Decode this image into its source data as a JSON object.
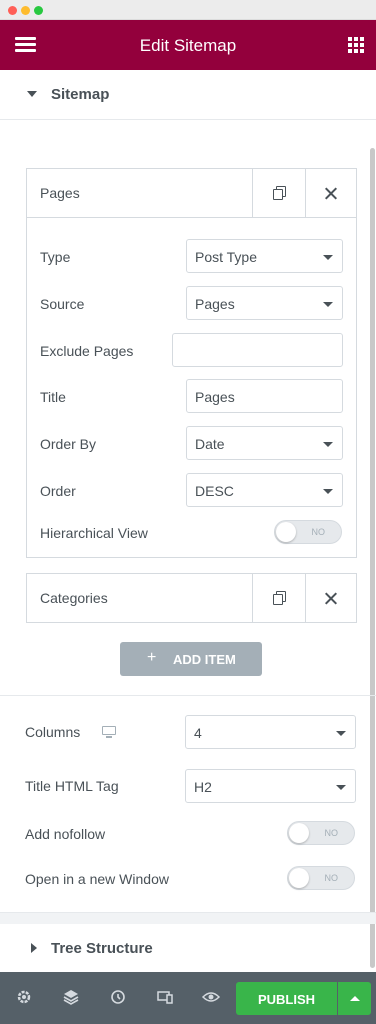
{
  "header": {
    "title": "Edit Sitemap"
  },
  "sections": {
    "sitemap": "Sitemap",
    "tree_structure": "Tree Structure"
  },
  "repeater": {
    "items": [
      {
        "title": "Pages",
        "fields": {
          "type": {
            "label": "Type",
            "value": "Post Type"
          },
          "source": {
            "label": "Source",
            "value": "Pages"
          },
          "exclude": {
            "label": "Exclude Pages",
            "value": ""
          },
          "title": {
            "label": "Title",
            "value": "Pages"
          },
          "order_by": {
            "label": "Order By",
            "value": "Date"
          },
          "order": {
            "label": "Order",
            "value": "DESC"
          },
          "hierarchical": {
            "label": "Hierarchical View",
            "state": "NO"
          }
        }
      },
      {
        "title": "Categories"
      }
    ],
    "add_item_label": "ADD ITEM"
  },
  "settings": {
    "columns": {
      "label": "Columns",
      "value": "4"
    },
    "title_tag": {
      "label": "Title HTML Tag",
      "value": "H2"
    },
    "nofollow": {
      "label": "Add nofollow",
      "state": "NO"
    },
    "new_window": {
      "label": "Open in a new Window",
      "state": "NO"
    }
  },
  "footer": {
    "publish_label": "PUBLISH"
  },
  "colors": {
    "header": "#93003c",
    "publish": "#39b54a",
    "footer": "#556068"
  },
  "icons": [
    "hamburger-icon",
    "apps-grid-icon",
    "duplicate-icon",
    "close-icon",
    "desktop-icon",
    "gear-icon",
    "layers-icon",
    "history-icon",
    "responsive-icon",
    "eye-icon",
    "caret-up-icon"
  ]
}
